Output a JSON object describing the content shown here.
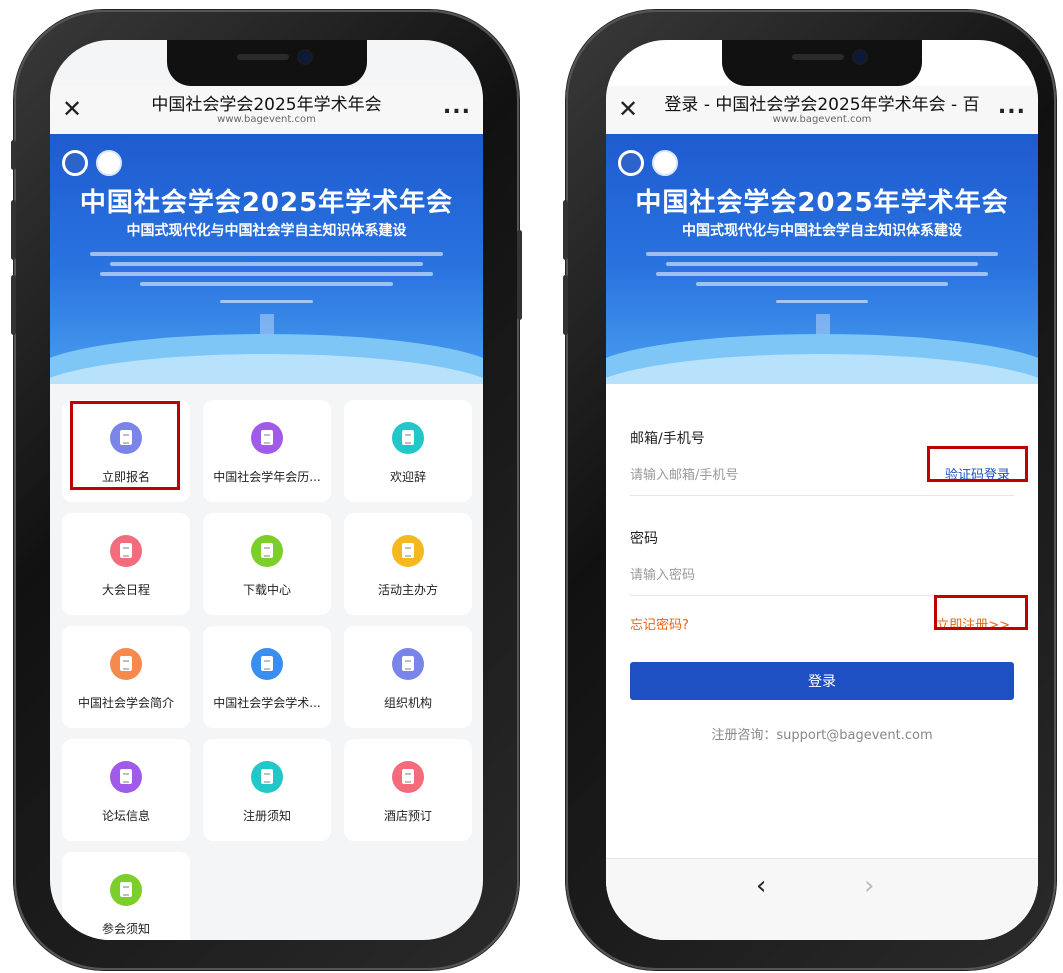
{
  "left_phone": {
    "title": "中国社会学会2025年学术年会",
    "url": "www.bagevent.com",
    "close_icon": "close-icon",
    "more_icon": "more-icon",
    "more_label": "...",
    "banner": {
      "title": "中国社会学会2025年学术年会",
      "subtitle": "中国式现代化与中国社会学自主知识体系建设"
    },
    "tiles": [
      {
        "label": "立即报名",
        "color": "#7b84e8"
      },
      {
        "label": "中国社会学年会历...",
        "color": "#a05be8"
      },
      {
        "label": "欢迎辞",
        "color": "#22c7c7"
      },
      {
        "label": "大会日程",
        "color": "#f46b7c"
      },
      {
        "label": "下载中心",
        "color": "#7ccf2a"
      },
      {
        "label": "活动主办方",
        "color": "#f4b820"
      },
      {
        "label": "中国社会学会简介",
        "color": "#f58a4c"
      },
      {
        "label": "中国社会学会学术...",
        "color": "#3a8ef0"
      },
      {
        "label": "组织机构",
        "color": "#7b84e8"
      },
      {
        "label": "论坛信息",
        "color": "#a05be8"
      },
      {
        "label": "注册须知",
        "color": "#22c7c7"
      },
      {
        "label": "酒店预订",
        "color": "#f46b7c"
      },
      {
        "label": "参会须知",
        "color": "#7ccf2a"
      }
    ]
  },
  "right_phone": {
    "title": "登录 - 中国社会学会2025年学术年会 - 百",
    "url": "www.bagevent.com",
    "more_label": "...",
    "banner": {
      "title": "中国社会学会2025年学术年会",
      "subtitle": "中国式现代化与中国社会学自主知识体系建设"
    },
    "form": {
      "account_label": "邮箱/手机号",
      "account_placeholder": "请输入邮箱/手机号",
      "code_login_link": "验证码登录",
      "password_label": "密码",
      "password_placeholder": "请输入密码",
      "forgot_link": "忘记密码?",
      "register_link": "立即注册>>",
      "login_button": "登录",
      "consult_text": "注册咨询：support@bagevent.com"
    },
    "nav": {
      "back": "‹",
      "forward": "›"
    }
  },
  "colors": {
    "accent_blue": "#1e50c4",
    "link_blue": "#1e50c4",
    "link_orange": "#e8631a",
    "highlight_red": "#c00000"
  }
}
